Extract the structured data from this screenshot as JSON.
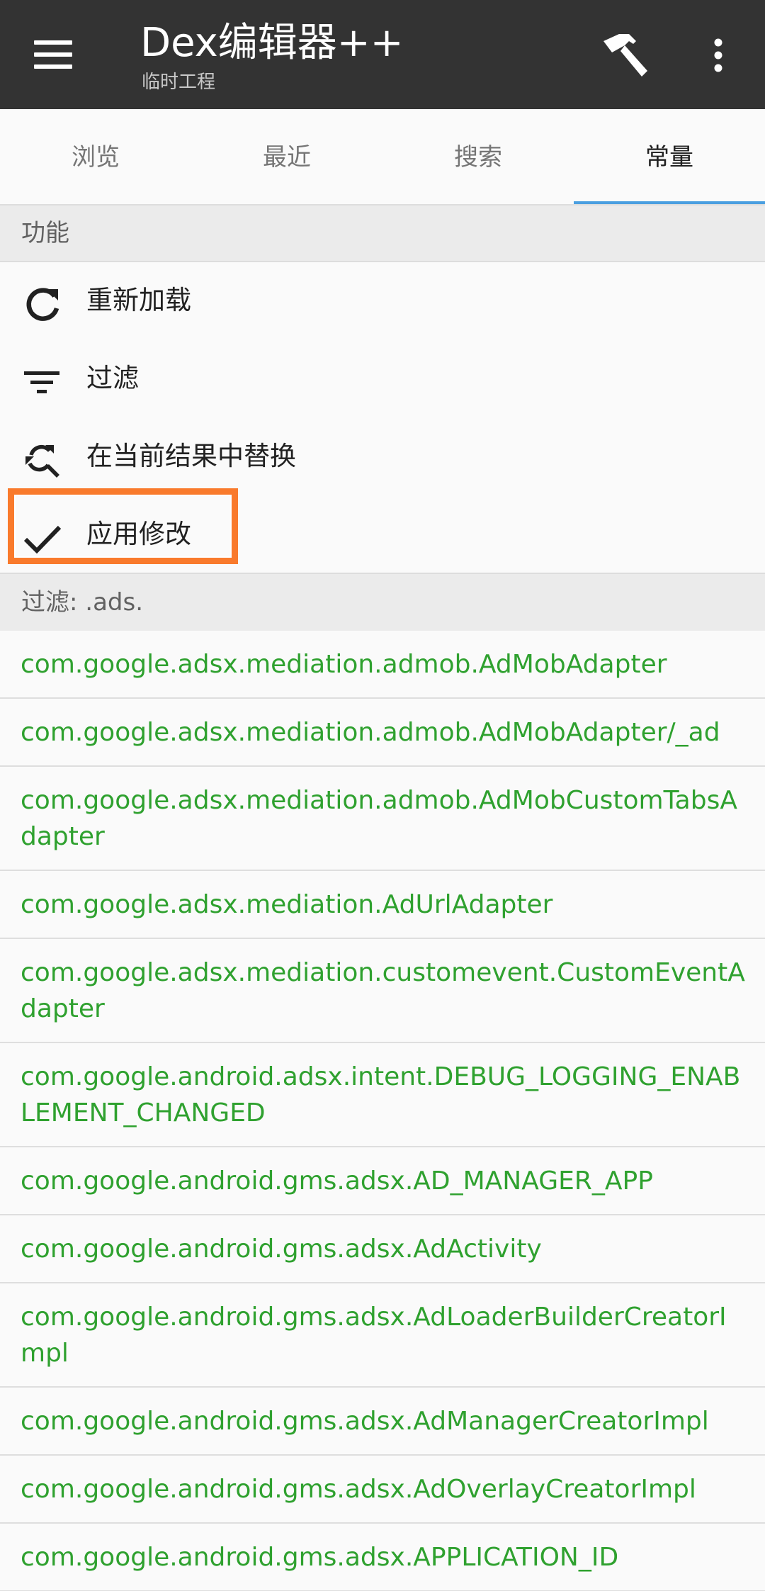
{
  "app_bar": {
    "title": "Dex编辑器++",
    "subtitle": "临时工程",
    "icons": [
      "menu-icon",
      "hammer-icon",
      "more-vert-icon"
    ]
  },
  "tabs": [
    {
      "label": "浏览",
      "active": false
    },
    {
      "label": "最近",
      "active": false
    },
    {
      "label": "搜索",
      "active": false
    },
    {
      "label": "常量",
      "active": true
    }
  ],
  "functions": {
    "header": "功能",
    "items": [
      {
        "label": "重新加载",
        "icon": "refresh-icon"
      },
      {
        "label": "过滤",
        "icon": "filter-icon"
      },
      {
        "label": "在当前结果中替换",
        "icon": "find-replace-icon"
      },
      {
        "label": "应用修改",
        "icon": "check-icon",
        "highlighted": true
      }
    ]
  },
  "filter": {
    "header": "过滤: .ads."
  },
  "constants": [
    "com.google.adsx.mediation.admob.AdMobAdapter",
    "com.google.adsx.mediation.admob.AdMobAdapter/_ad",
    "com.google.adsx.mediation.admob.AdMobCustomTabsAdapter",
    "com.google.adsx.mediation.AdUrlAdapter",
    "com.google.adsx.mediation.customevent.CustomEventAdapter",
    "com.google.android.adsx.intent.DEBUG_LOGGING_ENABLEMENT_CHANGED",
    "com.google.android.gms.adsx.AD_MANAGER_APP",
    "com.google.android.gms.adsx.AdActivity",
    "com.google.android.gms.adsx.AdLoaderBuilderCreatorImpl",
    "com.google.android.gms.adsx.AdManagerCreatorImpl",
    "com.google.android.gms.adsx.AdOverlayCreatorImpl",
    "com.google.android.gms.adsx.APPLICATION_ID"
  ],
  "colors": {
    "app_bar": "#333333",
    "tab_indicator": "#4a9fe0",
    "constant_text": "#2fa12f",
    "highlight": "#f97a2c"
  }
}
